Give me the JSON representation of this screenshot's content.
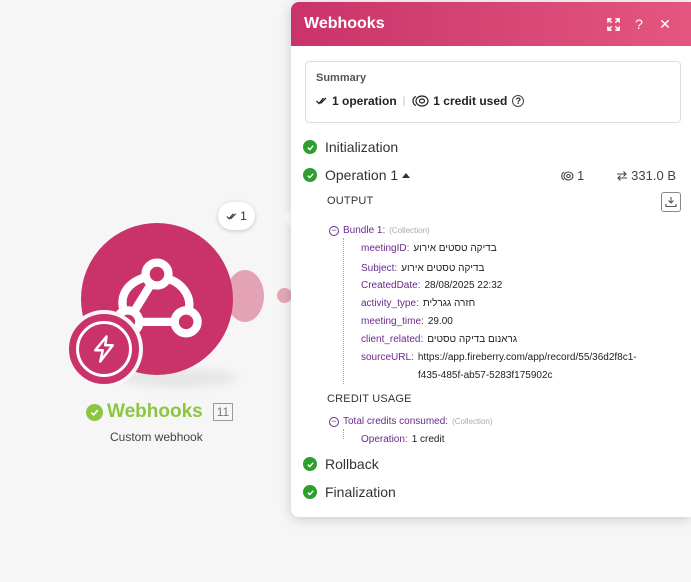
{
  "module": {
    "name": "Webhooks",
    "id": "11",
    "subtitle": "Custom webhook",
    "operations_bubble": "1",
    "color": "#c9336a",
    "status_color": "#8cc63f"
  },
  "panel": {
    "title": "Webhooks",
    "help_glyph": "?",
    "close_glyph": "✕",
    "summary": {
      "label": "Summary",
      "operations": "1 operation",
      "credits": "1 credit used",
      "help_glyph": "?"
    },
    "sections": {
      "initialization": "Initialization",
      "operation": "Operation 1",
      "rollback": "Rollback",
      "finalization": "Finalization"
    },
    "operation_stats": {
      "credits": "1",
      "size": "331.0 B"
    },
    "output": {
      "label": "OUTPUT",
      "bundle_label": "Bundle 1:",
      "bundle_type": "(Collection)",
      "fields": [
        {
          "key": "meetingID",
          "value": "בדיקה טסטים אירוע"
        },
        {
          "key": "Subject",
          "value": "בדיקה טסטים אירוע"
        },
        {
          "key": "CreatedDate",
          "value": "28/08/2025 22:32"
        },
        {
          "key": "activity_type",
          "value": "חזרה גגרלית"
        },
        {
          "key": "meeting_time",
          "value": "29.00"
        },
        {
          "key": "client_related",
          "value": "גראנום בדיקה טסטים"
        },
        {
          "key": "sourceURL",
          "value": "https://app.fireberry.com/app/record/55/36d2f8c1-",
          "value2": "f435-485f-ab57-5283f175902c"
        }
      ]
    },
    "credit_usage": {
      "label": "CREDIT USAGE",
      "total_label": "Total credits consumed:",
      "total_type": "(Collection)",
      "operation_key": "Operation",
      "operation_value": "1 credit"
    }
  }
}
